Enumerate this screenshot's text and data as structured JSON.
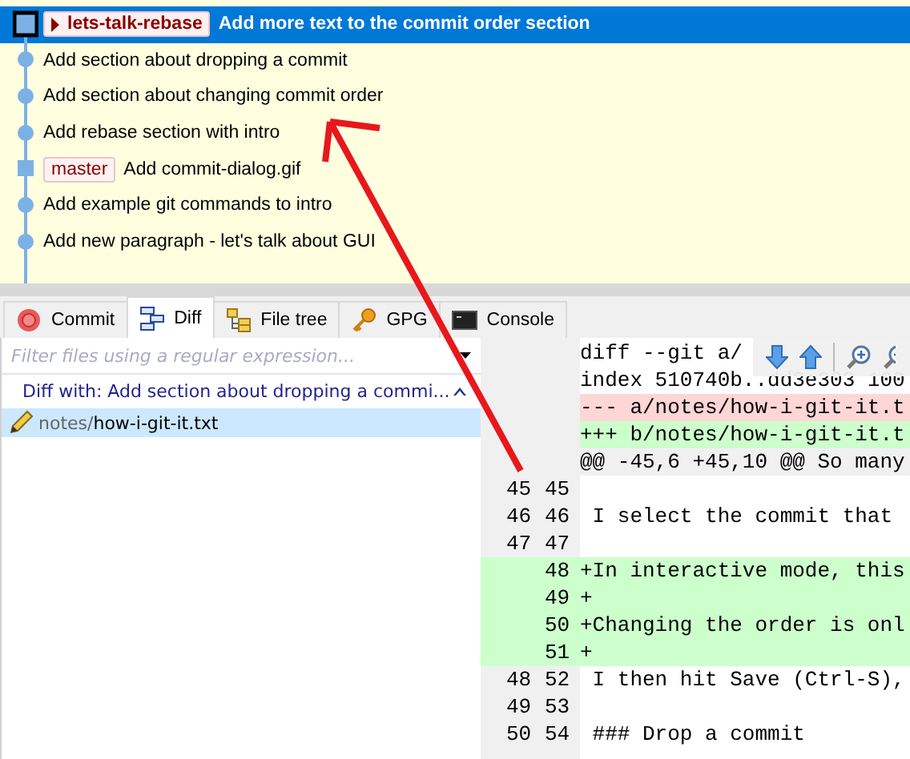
{
  "commit_graph": {
    "commits": [
      {
        "message": "Add more text to the commit order section",
        "selected": true,
        "kind": "current",
        "refs": [
          {
            "name": "lets-talk-rebase",
            "kind": "head"
          }
        ]
      },
      {
        "message": "Add section about dropping a commit",
        "selected": false,
        "kind": "circle"
      },
      {
        "message": "Add section about changing commit order",
        "selected": false,
        "kind": "circle"
      },
      {
        "message": "Add rebase section with intro",
        "selected": false,
        "kind": "circle"
      },
      {
        "message": "Add commit-dialog.gif",
        "selected": false,
        "kind": "square",
        "refs": [
          {
            "name": "master",
            "kind": "branch"
          }
        ]
      },
      {
        "message": "Add example git commands to intro",
        "selected": false,
        "kind": "circle"
      },
      {
        "message": "Add new paragraph - let's talk about GUI",
        "selected": false,
        "kind": "circle"
      }
    ]
  },
  "tabs": [
    {
      "label": "Commit",
      "selected": false
    },
    {
      "label": "Diff",
      "selected": true
    },
    {
      "label": "File tree",
      "selected": false
    },
    {
      "label": "GPG",
      "selected": false
    },
    {
      "label": "Console",
      "selected": false
    }
  ],
  "file_filter": {
    "placeholder": "Filter files using a regular expression..."
  },
  "diff_with": {
    "label": "Diff with: Add section about dropping a commi..."
  },
  "files": [
    {
      "directory": "notes/",
      "name": "how-i-git-it.txt",
      "selected": true
    }
  ],
  "diff_view": {
    "lines": [
      {
        "kind": "meta",
        "text": "diff --git a/"
      },
      {
        "kind": "meta",
        "text": "index 510740b..dd3e303 100"
      },
      {
        "kind": "file-removed",
        "text": "--- a/notes/how-i-git-it.t"
      },
      {
        "kind": "file-added",
        "text": "+++ b/notes/how-i-git-it.t"
      },
      {
        "kind": "hunk",
        "text": "@@ -45,6 +45,10 @@ So many"
      },
      {
        "kind": "context",
        "old": "45",
        "new": "45"
      },
      {
        "kind": "context",
        "old": "46",
        "new": "46",
        "text": " I select the commit that"
      },
      {
        "kind": "context",
        "old": "47",
        "new": "47"
      },
      {
        "kind": "added",
        "new": "48",
        "text": "+In interactive mode, this"
      },
      {
        "kind": "added",
        "new": "49",
        "text": "+"
      },
      {
        "kind": "added",
        "new": "50",
        "text": "+Changing the order is onl"
      },
      {
        "kind": "added",
        "new": "51",
        "text": "+"
      },
      {
        "kind": "context",
        "old": "48",
        "new": "52",
        "text": " I then hit Save (Ctrl-S),"
      },
      {
        "kind": "context",
        "old": "49",
        "new": "53"
      },
      {
        "kind": "context",
        "old": "50",
        "new": "54",
        "text": " ### Drop a commit"
      }
    ]
  }
}
